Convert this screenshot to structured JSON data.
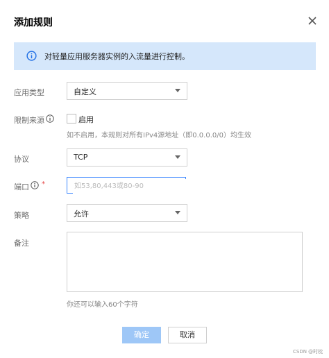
{
  "dialog": {
    "title": "添加规则",
    "close_icon": "close-icon"
  },
  "info": {
    "icon": "info-icon",
    "text": "对轻量应用服务器实例的入流量进行控制。"
  },
  "form": {
    "app_type": {
      "label": "应用类型",
      "value": "自定义"
    },
    "source_limit": {
      "label": "限制来源",
      "checkbox_label": "启用",
      "checked": false,
      "hint": "如不启用，本规则对所有IPv4源地址（即0.0.0.0/0）均生效"
    },
    "protocol": {
      "label": "协议",
      "value": "TCP"
    },
    "port": {
      "label": "端口",
      "required_mark": "*",
      "placeholder": "如53,80,443或80-90",
      "value": ""
    },
    "policy": {
      "label": "策略",
      "value": "允许"
    },
    "remark": {
      "label": "备注",
      "value": "",
      "hint": "你还可以输入60个字符"
    }
  },
  "buttons": {
    "ok": "确定",
    "cancel": "取消"
  },
  "watermark": "CSDN @时枕",
  "colors": {
    "info_bg": "#d5e7fb",
    "accent": "#1f6fe5",
    "ok_disabled": "#9ec7f7",
    "required": "#e54545"
  }
}
